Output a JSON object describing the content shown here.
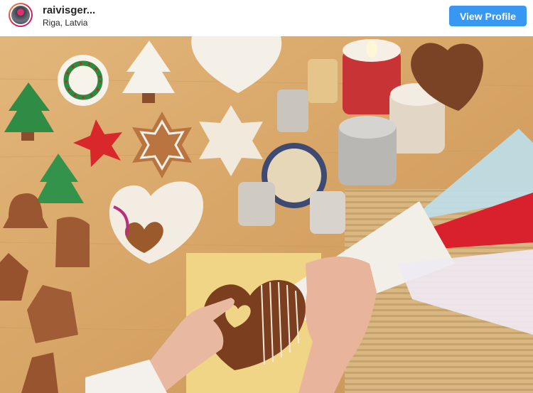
{
  "header": {
    "username": "raivisger...",
    "location": "Riga, Latvia",
    "view_profile_label": "View Profile"
  },
  "icons": {
    "avatar": "profile-avatar",
    "photo": "gingerbread-decorating-photo"
  },
  "colors": {
    "button": "#3897f0",
    "username_text": "#262626",
    "table_wood": "#d9aa6e"
  }
}
